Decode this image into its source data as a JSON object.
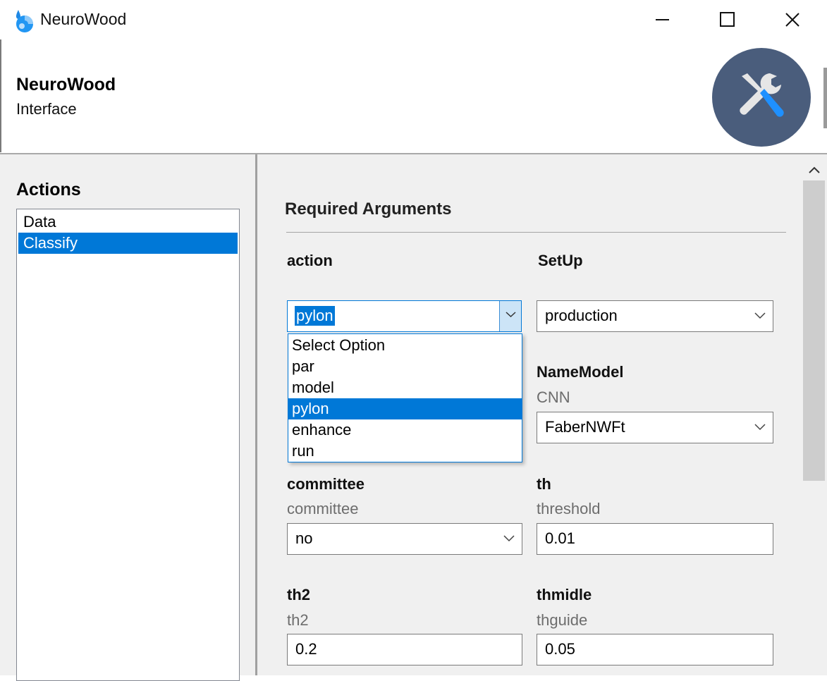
{
  "window": {
    "title": "NeuroWood",
    "icon": "droplet-logo-icon",
    "controls": [
      "minimize-icon",
      "maximize-icon",
      "close-icon"
    ]
  },
  "header": {
    "title": "NeuroWood",
    "subtitle": "Interface",
    "logo_icon": "tools-icon",
    "logo_bg": "#4a5d7c",
    "logo_accent": "#1e90ff"
  },
  "actions": {
    "title": "Actions",
    "items": [
      {
        "label": "Data",
        "selected": false
      },
      {
        "label": "Classify",
        "selected": true
      }
    ]
  },
  "form": {
    "section_title": "Required Arguments",
    "action": {
      "label": "action",
      "value": "pylon",
      "options": [
        "Select Option",
        "par",
        "model",
        "pylon",
        "enhance",
        "run"
      ]
    },
    "setup": {
      "label": "SetUp",
      "value": "production"
    },
    "namemodel": {
      "label": "NameModel",
      "help": "CNN",
      "value": "FaberNWFt"
    },
    "committee": {
      "label": "committee",
      "help": "committee",
      "value": "no"
    },
    "th": {
      "label": "th",
      "help": "threshold",
      "value": "0.01"
    },
    "th2": {
      "label": "th2",
      "help": "th2",
      "value": "0.2"
    },
    "thmidle": {
      "label": "thmidle",
      "help": "thguide",
      "value": "0.05"
    }
  },
  "colors": {
    "accent": "#0078d7",
    "panel_bg": "#f0f0f0"
  }
}
